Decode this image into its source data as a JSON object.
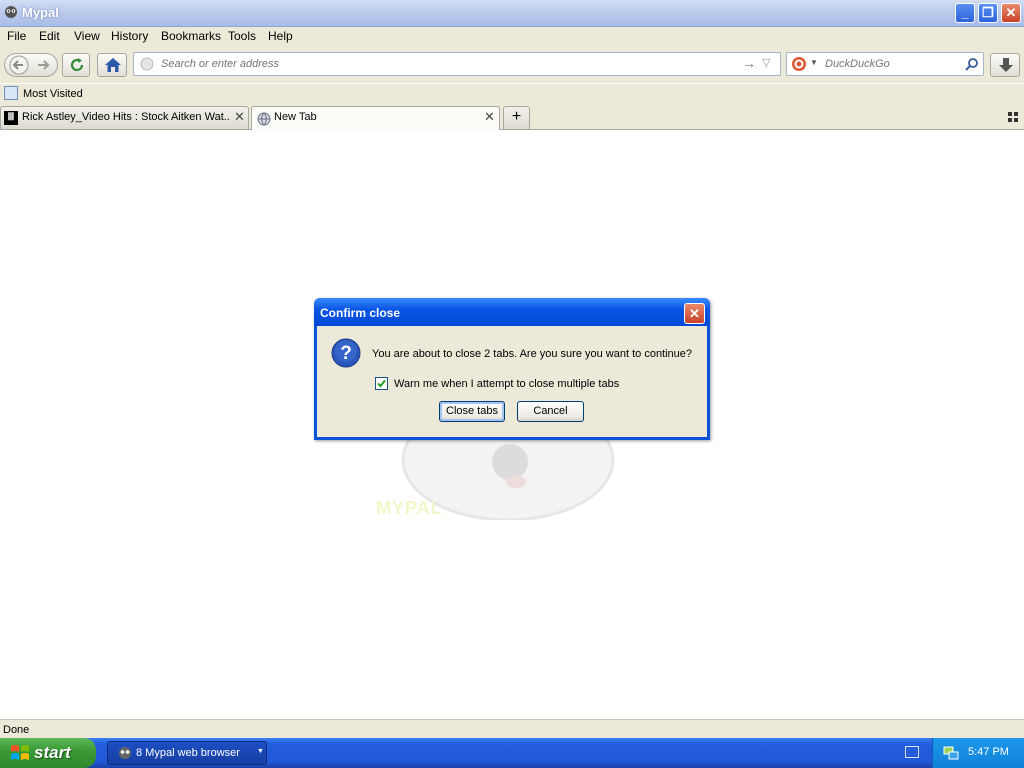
{
  "window": {
    "title": "Mypal",
    "min_icon": "minimize-icon",
    "max_icon": "restore-icon",
    "close_icon": "close-icon"
  },
  "menu": [
    "File",
    "Edit",
    "View",
    "History",
    "Bookmarks",
    "Tools",
    "Help"
  ],
  "navbar": {
    "url_placeholder": "Search or enter address",
    "search_placeholder": "DuckDuckGo"
  },
  "bookmarks": {
    "most_visited": "Most Visited"
  },
  "tabs": [
    {
      "label": "Rick Astley_Video Hits : Stock Aitken Wat...",
      "close": "✕"
    },
    {
      "label": "New Tab",
      "close": "✕"
    }
  ],
  "newtab_button": "+",
  "content": {
    "watermark": "MYPAL"
  },
  "dialog": {
    "title": "Confirm close",
    "message": "You are about to close 2 tabs. Are you sure you want to continue?",
    "checkbox_label": "Warn me when I attempt to close multiple tabs",
    "checkbox_checked": true,
    "confirm_label": "Close tabs",
    "cancel_label": "Cancel",
    "close_glyph": "✕"
  },
  "status": "Done",
  "taskbar": {
    "start_label": "start",
    "task_label": "8 Mypal web browser",
    "clock": "5:47 PM"
  }
}
